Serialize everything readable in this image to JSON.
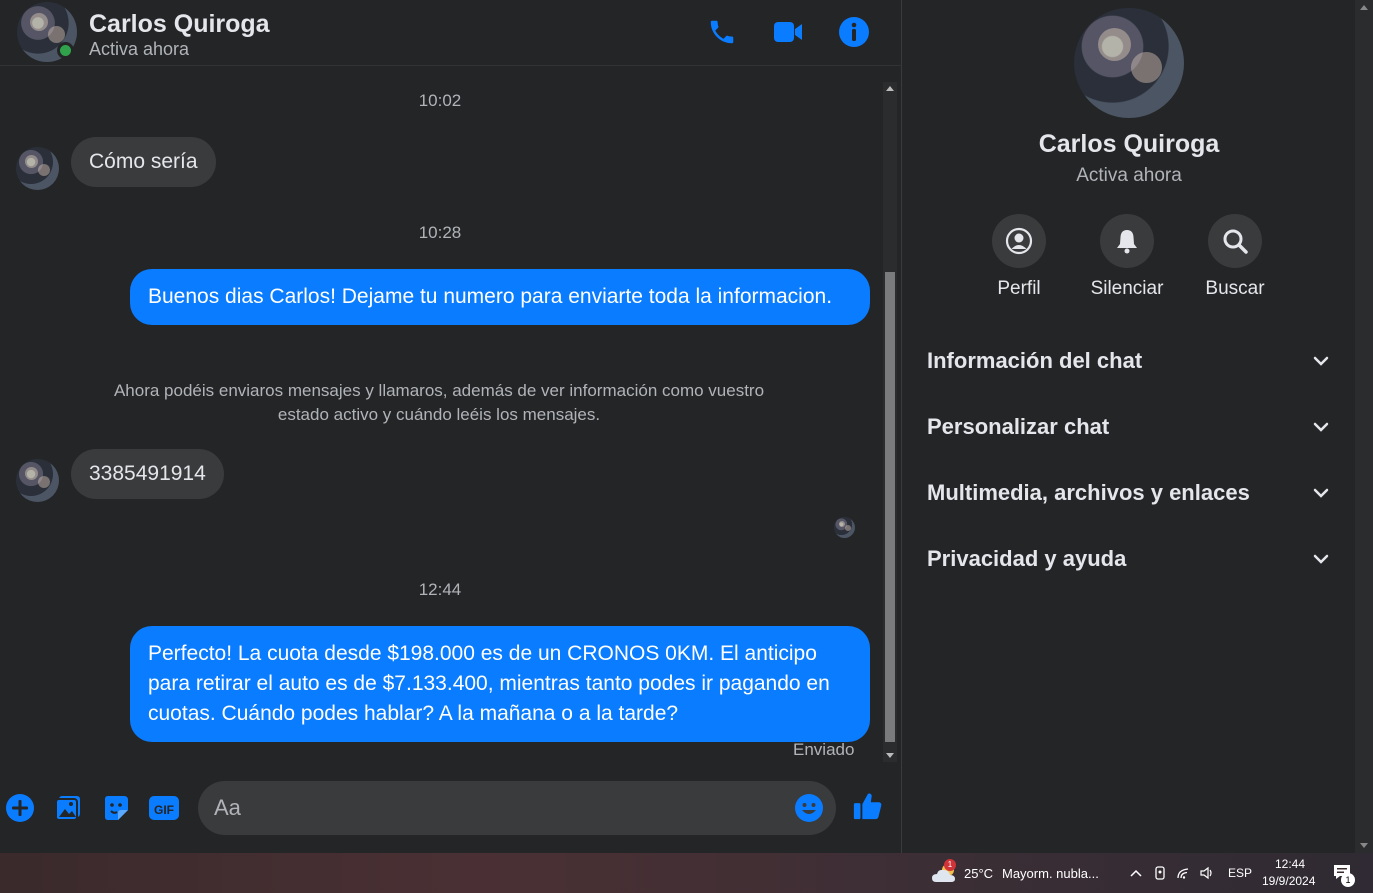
{
  "header": {
    "name": "Carlos Quiroga",
    "status": "Activa ahora",
    "icons": [
      "phone-icon",
      "video-call-icon",
      "info-icon"
    ]
  },
  "messages": {
    "timestamps": [
      "10:02",
      "10:28",
      "12:44"
    ],
    "incoming": [
      "Cómo sería",
      "3385491914"
    ],
    "outgoing": [
      "Buenos dias Carlos! Dejame tu numero para enviarte toda la informacion.",
      "Perfecto! La cuota desde $198.000 es de un CRONOS 0KM. El anticipo para retirar el auto es de $7.133.400, mientras tanto podes ir pagando en cuotas. Cuándo podes hablar? A la mañana o a la tarde?"
    ],
    "system_note": "Ahora podéis enviaros mensajes y llamaros, además de ver información como vuestro estado activo y cuándo leéis los mensajes.",
    "sent_status": "Enviado"
  },
  "composer": {
    "placeholder": "Aa",
    "icons": [
      "add-icon",
      "photo-icon",
      "sticker-icon",
      "gif-icon",
      "emoji-icon",
      "like-icon"
    ]
  },
  "panel": {
    "name": "Carlos Quiroga",
    "status": "Activa ahora",
    "actions": [
      {
        "label": "Perfil",
        "icon": "profile-icon"
      },
      {
        "label": "Silenciar",
        "icon": "bell-icon"
      },
      {
        "label": "Buscar",
        "icon": "search-icon"
      }
    ],
    "sections": [
      "Información del chat",
      "Personalizar chat",
      "Multimedia, archivos y enlaces",
      "Privacidad y ayuda"
    ]
  },
  "taskbar": {
    "weather_badge": "1",
    "temperature": "25°C",
    "weather_text": "Mayorm. nubla...",
    "language": "ESP",
    "time": "12:44",
    "date": "19/9/2024",
    "notification_count": "1"
  },
  "colors": {
    "accent": "#0a7cff",
    "background": "#242526",
    "bubble_incoming": "#3a3b3c",
    "online": "#31a24c"
  }
}
